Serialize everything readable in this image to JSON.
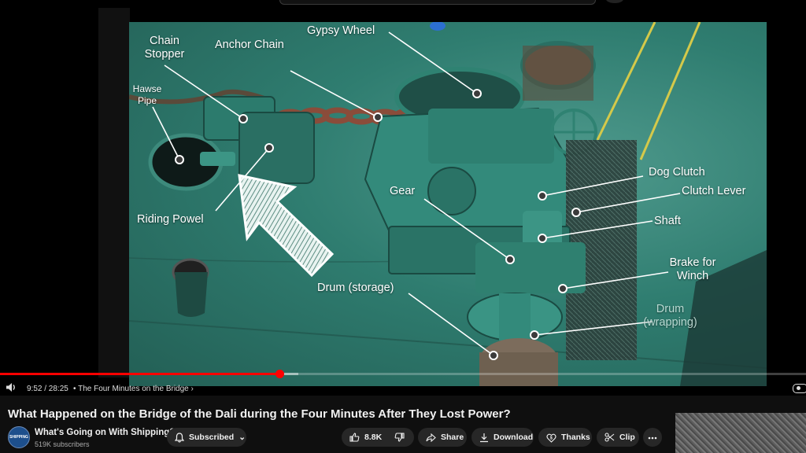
{
  "player": {
    "time_display": "9:52 / 28:25",
    "chapter_label": "• The Four Minutes on the Bridge",
    "progress_fraction": 0.347,
    "buffered_fraction": 0.37
  },
  "diagram_labels": {
    "chain_stopper": "Chain\nStopper",
    "anchor_chain": "Anchor Chain",
    "gypsy_wheel": "Gypsy Wheel",
    "hawse_pipe": "Hawse\nPipe",
    "riding_powel": "Riding Powel",
    "gear": "Gear",
    "dog_clutch": "Dog Clutch",
    "clutch_lever": "Clutch Lever",
    "shaft": "Shaft",
    "brake_for_winch": "Brake for\nWinch",
    "drum_storage": "Drum (storage)",
    "drum_wrapping": "Drum\n(wrapping)"
  },
  "video": {
    "title": "What Happened on the Bridge of the Dali during the Four Minutes After They Lost Power?"
  },
  "channel": {
    "name": "What's Going on With Shipping?",
    "subscribers": "519K subscribers",
    "avatar_text": "SHIPPING"
  },
  "actions": {
    "subscribed": "Subscribed",
    "like_count": "8.8K",
    "share": "Share",
    "download": "Download",
    "thanks": "Thanks",
    "clip": "Clip"
  },
  "colors": {
    "progress": "#ff0000",
    "pill_bg": "#272727",
    "page_bg": "#0f0f0f"
  }
}
